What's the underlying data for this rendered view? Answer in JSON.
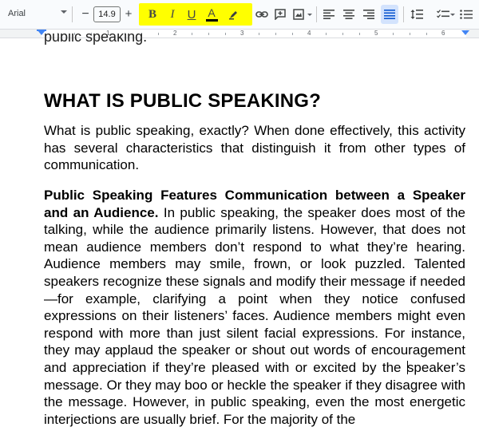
{
  "toolbar": {
    "font_name": "Arial",
    "font_size": "14.9",
    "minus_label": "−",
    "plus_label": "+",
    "bold_label": "B",
    "italic_label": "I",
    "underline_label": "U",
    "text_color_label": "A",
    "highlight_color": "#ffff00",
    "icons": [
      "pen-highlight-icon",
      "link-icon",
      "comment-add-icon",
      "image-icon",
      "align-left-icon",
      "align-center-icon",
      "align-right-icon",
      "align-justify-icon",
      "line-spacing-icon",
      "checklist-icon",
      "bulleted-list-icon"
    ]
  },
  "ruler": {
    "numbers": [
      "1",
      "2",
      "3",
      "4",
      "5",
      "6"
    ]
  },
  "document": {
    "cut_line": "public speaking.",
    "heading": "WHAT IS PUBLIC SPEAKING?",
    "paragraph1": "What is public speaking, exactly? When done effectively, this activity has several characteristics that distinguish it from other types of communication.",
    "paragraph2_bold": "Public Speaking Features Communication between a Speaker and an Audience.",
    "paragraph2_a": " In public speaking, the speaker does most of the talking, while the audience primarily listens. However, that does not mean audience members don’t respond to what they’re hearing. Audience members may smile, frown, or look puzzled. Talented speakers recognize these signals and modify their message if needed—for example, clarifying a point when they notice confused expressions on their listeners’ faces. Audience members might even respond with more than just silent facial expressions. For instance, they may applaud the speaker or shout out words of encouragement and appreciation if they’re pleased with or excited by the ",
    "paragraph2_b": "speaker’s message. Or they may boo or heckle the speaker if they disagree with the message. However, in public speaking, even the most energetic interjections are usually brief. For the majority of the"
  }
}
